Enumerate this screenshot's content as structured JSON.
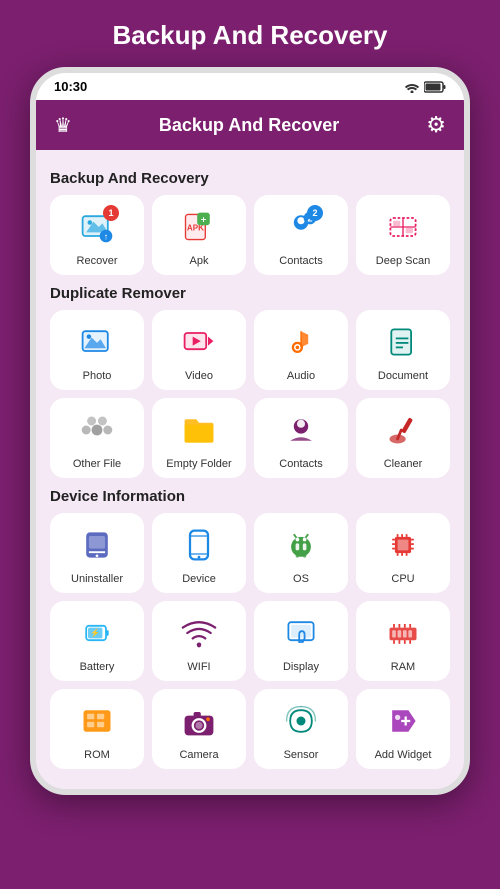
{
  "page": {
    "title": "Backup And Recovery",
    "status_time": "10:30"
  },
  "topbar": {
    "title": "Backup And Recover"
  },
  "sections": [
    {
      "title": "Backup And Recovery",
      "items": [
        {
          "id": "recover",
          "label": "Recover",
          "icon": "recover"
        },
        {
          "id": "apk",
          "label": "Apk",
          "icon": "apk"
        },
        {
          "id": "contacts-backup",
          "label": "Contacts",
          "icon": "contacts-b"
        },
        {
          "id": "deep-scan",
          "label": "Deep Scan",
          "icon": "deepscan"
        }
      ]
    },
    {
      "title": "Duplicate Remover",
      "items": [
        {
          "id": "photo",
          "label": "Photo",
          "icon": "photo"
        },
        {
          "id": "video",
          "label": "Video",
          "icon": "video"
        },
        {
          "id": "audio",
          "label": "Audio",
          "icon": "audio"
        },
        {
          "id": "document",
          "label": "Document",
          "icon": "document"
        },
        {
          "id": "other-file",
          "label": "Other File",
          "icon": "otherfile"
        },
        {
          "id": "empty-folder",
          "label": "Empty Folder",
          "icon": "emptyfolder"
        },
        {
          "id": "contacts-dup",
          "label": "Contacts",
          "icon": "contacts2"
        },
        {
          "id": "cleaner",
          "label": "Cleaner",
          "icon": "cleaner"
        }
      ]
    },
    {
      "title": "Device Information",
      "items": [
        {
          "id": "uninstaller",
          "label": "Uninstaller",
          "icon": "uninstaller"
        },
        {
          "id": "device",
          "label": "Device",
          "icon": "device"
        },
        {
          "id": "os",
          "label": "OS",
          "icon": "os"
        },
        {
          "id": "cpu",
          "label": "CPU",
          "icon": "cpu"
        },
        {
          "id": "battery",
          "label": "Battery",
          "icon": "battery"
        },
        {
          "id": "wifi",
          "label": "WIFI",
          "icon": "wifi"
        },
        {
          "id": "display",
          "label": "Display",
          "icon": "display"
        },
        {
          "id": "ram",
          "label": "RAM",
          "icon": "ram"
        },
        {
          "id": "rom",
          "label": "ROM",
          "icon": "rom"
        },
        {
          "id": "camera",
          "label": "Camera",
          "icon": "camera"
        },
        {
          "id": "sensor",
          "label": "Sensor",
          "icon": "sensor"
        },
        {
          "id": "add-widget",
          "label": "Add Widget",
          "icon": "addwidget"
        }
      ]
    }
  ]
}
